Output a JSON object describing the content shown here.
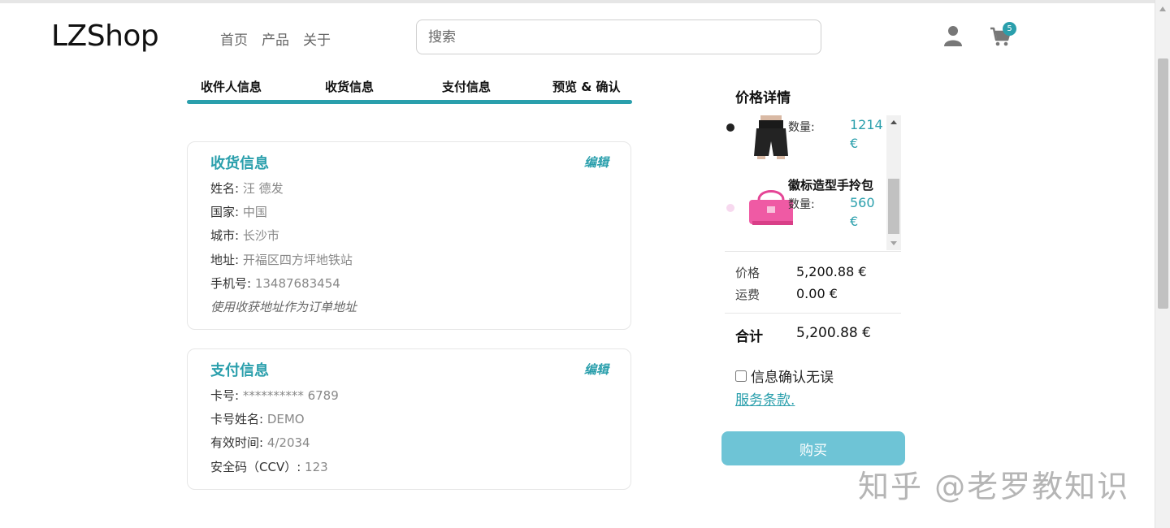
{
  "header": {
    "logo": "LZShop",
    "nav": [
      "首页",
      "产品",
      "关于"
    ],
    "search_placeholder": "搜索",
    "cart_count": "5"
  },
  "steps": [
    "收件人信息",
    "收货信息",
    "支付信息",
    "预览 & 确认"
  ],
  "shipping": {
    "title": "收货信息",
    "edit": "编辑",
    "rows": [
      {
        "label": "姓名: ",
        "value": "汪 德发"
      },
      {
        "label": "国家: ",
        "value": "中国"
      },
      {
        "label": "城市: ",
        "value": "长沙市"
      },
      {
        "label": "地址: ",
        "value": "开福区四方坪地铁站"
      },
      {
        "label": "手机号: ",
        "value": "13487683454"
      }
    ],
    "note": "使用收获地址作为订单地址"
  },
  "payment": {
    "title": "支付信息",
    "edit": "编辑",
    "rows": [
      {
        "label": "卡号: ",
        "value": "********** 6789"
      },
      {
        "label": "卡号姓名: ",
        "value": "DEMO"
      },
      {
        "label": "有效时间: ",
        "value": "4/2034"
      },
      {
        "label": "安全码（CCV）: ",
        "value": "123"
      }
    ]
  },
  "summary": {
    "title": "价格详情",
    "items": [
      {
        "name": "",
        "qty_label": "数量:",
        "price": "1214 €",
        "dot_color": "#222222"
      },
      {
        "name": "徽标造型手拎包",
        "qty_label": "数量:",
        "price": "560 €",
        "dot_color": "#f7d9ef"
      }
    ],
    "price_label": "价格",
    "price_value": "5,200.88 €",
    "shipping_label": "运费",
    "shipping_value": "0.00 €",
    "total_label": "合计",
    "total_value": "5,200.88 €",
    "confirm_label": "信息确认无误",
    "terms_label": "服务条款.",
    "buy_label": "购买"
  },
  "watermark": "知乎 @老罗教知识",
  "colors": {
    "accent": "#2a9fac",
    "button": "#6ec4d6"
  }
}
